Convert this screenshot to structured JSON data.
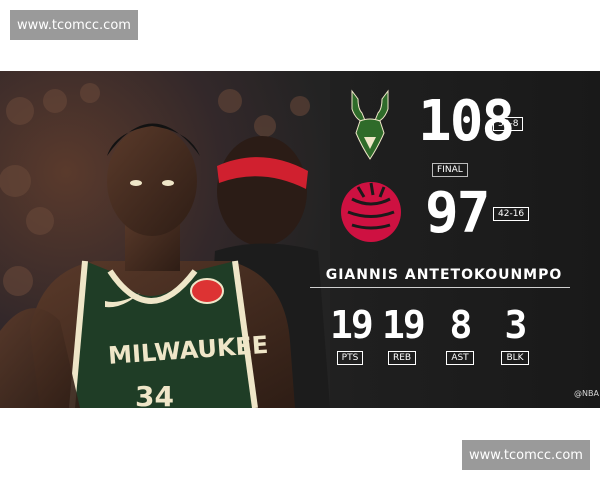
{
  "watermarks": {
    "top": "www.tcomcc.com",
    "bottom": "www.tcomcc.com"
  },
  "game": {
    "home": {
      "team_icon": "bucks-logo-icon",
      "score": "108",
      "record": "50-8",
      "color": "#2f6b2a"
    },
    "away": {
      "team_icon": "raptors-logo-icon",
      "score": "97",
      "record": "42-16",
      "color": "#ce1141"
    },
    "status": "FINAL"
  },
  "player": {
    "name": "GIANNIS ANTETOKOUNMPO",
    "jersey_text": "MILWAUKEE",
    "jersey_number": "34",
    "stats": [
      {
        "value": "19",
        "label": "PTS"
      },
      {
        "value": "19",
        "label": "REB"
      },
      {
        "value": "8",
        "label": "AST"
      },
      {
        "value": "3",
        "label": "BLK"
      }
    ]
  },
  "credit": "@NBA"
}
